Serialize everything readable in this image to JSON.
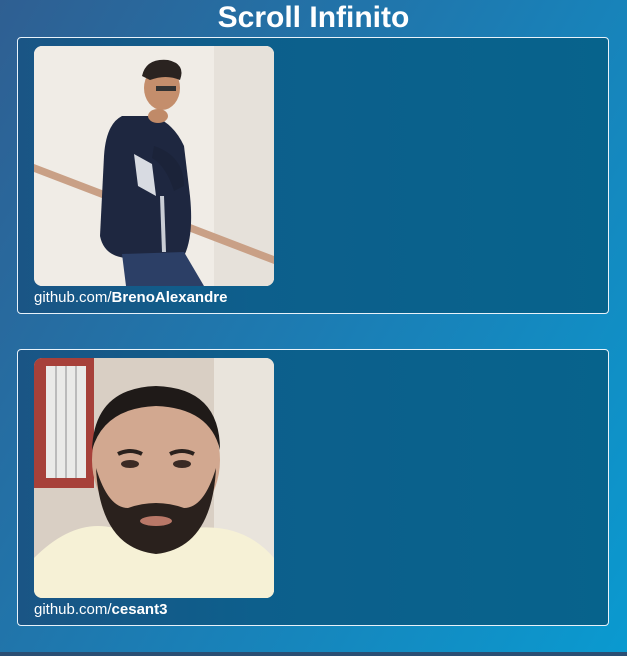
{
  "page": {
    "title": "Scroll Infinito"
  },
  "profiles": [
    {
      "link_prefix": "github.com/",
      "username": "BrenoAlexandre",
      "photo_icon": "profile-photo"
    },
    {
      "link_prefix": "github.com/",
      "username": "cesant3",
      "photo_icon": "profile-photo"
    }
  ],
  "colors": {
    "background_start": "#2f5f92",
    "background_end": "#0a9ad0",
    "card_border": "#e8f2fa",
    "text": "#ffffff"
  }
}
